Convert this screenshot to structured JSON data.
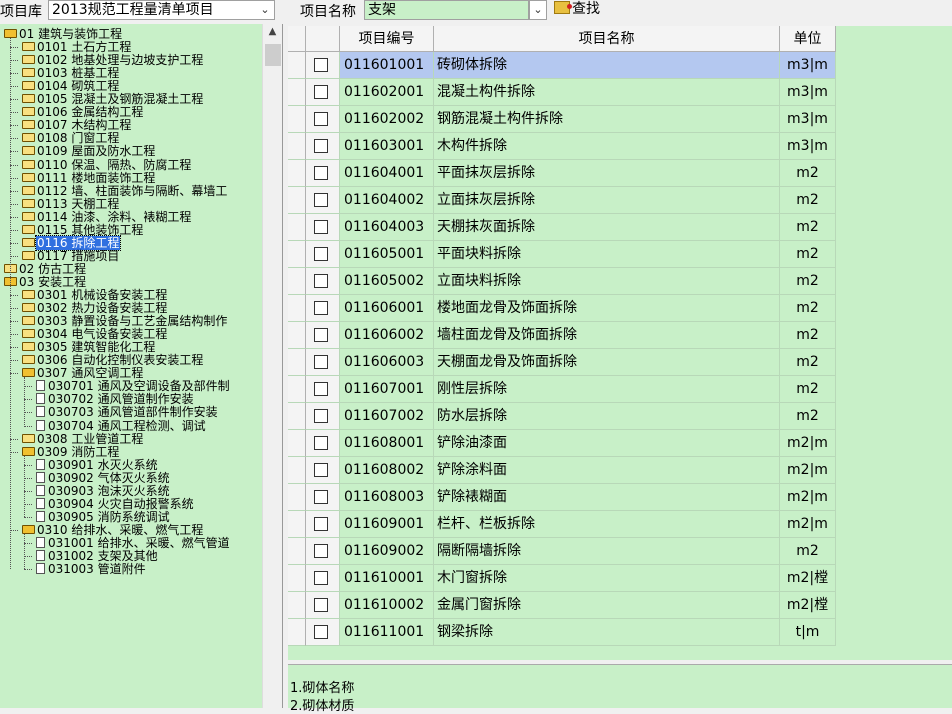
{
  "toolbar": {
    "library_label": "项目库",
    "library_value": "2013规范工程量清单项目",
    "name_label": "项目名称",
    "name_value": "支架",
    "find_label": "查找"
  },
  "tree": [
    {
      "label": "01 建筑与装饰工程",
      "type": "folder-open"
    },
    {
      "label": "0101 土石方工程",
      "type": "folder"
    },
    {
      "label": "0102 地基处理与边坡支护工程",
      "type": "folder"
    },
    {
      "label": "0103 桩基工程",
      "type": "folder"
    },
    {
      "label": "0104 砌筑工程",
      "type": "folder"
    },
    {
      "label": "0105 混凝土及钢筋混凝土工程",
      "type": "folder"
    },
    {
      "label": "0106 金属结构工程",
      "type": "folder"
    },
    {
      "label": "0107 木结构工程",
      "type": "folder"
    },
    {
      "label": "0108 门窗工程",
      "type": "folder"
    },
    {
      "label": "0109 屋面及防水工程",
      "type": "folder"
    },
    {
      "label": "0110 保温、隔热、防腐工程",
      "type": "folder"
    },
    {
      "label": "0111 楼地面装饰工程",
      "type": "folder"
    },
    {
      "label": "0112 墙、柱面装饰与隔断、幕墙工",
      "type": "folder"
    },
    {
      "label": "0113 天棚工程",
      "type": "folder"
    },
    {
      "label": "0114 油漆、涂料、裱糊工程",
      "type": "folder"
    },
    {
      "label": "0115 其他装饰工程",
      "type": "folder"
    },
    {
      "label": "0116 拆除工程",
      "type": "folder",
      "selected": true
    },
    {
      "label": "0117 措施项目",
      "type": "folder"
    },
    {
      "label": "02 仿古工程",
      "type": "folder"
    },
    {
      "label": "03 安装工程",
      "type": "folder-open"
    },
    {
      "label": "0301 机械设备安装工程",
      "type": "folder"
    },
    {
      "label": "0302 热力设备安装工程",
      "type": "folder"
    },
    {
      "label": "0303 静置设备与工艺金属结构制作",
      "type": "folder"
    },
    {
      "label": "0304 电气设备安装工程",
      "type": "folder"
    },
    {
      "label": "0305 建筑智能化工程",
      "type": "folder"
    },
    {
      "label": "0306 自动化控制仪表安装工程",
      "type": "folder"
    },
    {
      "label": "0307 通风空调工程",
      "type": "folder-open"
    },
    {
      "label": "030701 通风及空调设备及部件制",
      "type": "doc"
    },
    {
      "label": "030702 通风管道制作安装",
      "type": "doc"
    },
    {
      "label": "030703 通风管道部件制作安装",
      "type": "doc"
    },
    {
      "label": "030704 通风工程检测、调试",
      "type": "doc"
    },
    {
      "label": "0308 工业管道工程",
      "type": "folder"
    },
    {
      "label": "0309 消防工程",
      "type": "folder-open"
    },
    {
      "label": "030901 水灭火系统",
      "type": "doc"
    },
    {
      "label": "030902 气体灭火系统",
      "type": "doc"
    },
    {
      "label": "030903 泡沫灭火系统",
      "type": "doc"
    },
    {
      "label": "030904 火灾自动报警系统",
      "type": "doc"
    },
    {
      "label": "030905 消防系统调试",
      "type": "doc"
    },
    {
      "label": "0310 给排水、采暖、燃气工程",
      "type": "folder-open"
    },
    {
      "label": "031001 给排水、采暖、燃气管道",
      "type": "doc"
    },
    {
      "label": "031002 支架及其他",
      "type": "doc"
    },
    {
      "label": "031003 管道附件",
      "type": "doc"
    }
  ],
  "table": {
    "headers": {
      "code": "项目编号",
      "name": "项目名称",
      "unit": "单位"
    },
    "rows": [
      {
        "code": "011601001",
        "name": "砖砌体拆除",
        "unit": "m3|m"
      },
      {
        "code": "011602001",
        "name": "混凝土构件拆除",
        "unit": "m3|m"
      },
      {
        "code": "011602002",
        "name": "钢筋混凝土构件拆除",
        "unit": "m3|m"
      },
      {
        "code": "011603001",
        "name": "木构件拆除",
        "unit": "m3|m"
      },
      {
        "code": "011604001",
        "name": "平面抹灰层拆除",
        "unit": "m2"
      },
      {
        "code": "011604002",
        "name": "立面抹灰层拆除",
        "unit": "m2"
      },
      {
        "code": "011604003",
        "name": "天棚抹灰面拆除",
        "unit": "m2"
      },
      {
        "code": "011605001",
        "name": "平面块料拆除",
        "unit": "m2"
      },
      {
        "code": "011605002",
        "name": "立面块料拆除",
        "unit": "m2"
      },
      {
        "code": "011606001",
        "name": "楼地面龙骨及饰面拆除",
        "unit": "m2"
      },
      {
        "code": "011606002",
        "name": "墙柱面龙骨及饰面拆除",
        "unit": "m2"
      },
      {
        "code": "011606003",
        "name": "天棚面龙骨及饰面拆除",
        "unit": "m2"
      },
      {
        "code": "011607001",
        "name": "刚性层拆除",
        "unit": "m2"
      },
      {
        "code": "011607002",
        "name": "防水层拆除",
        "unit": "m2"
      },
      {
        "code": "011608001",
        "name": "铲除油漆面",
        "unit": "m2|m"
      },
      {
        "code": "011608002",
        "name": "铲除涂料面",
        "unit": "m2|m"
      },
      {
        "code": "011608003",
        "name": "铲除裱糊面",
        "unit": "m2|m"
      },
      {
        "code": "011609001",
        "name": "栏杆、栏板拆除",
        "unit": "m2|m"
      },
      {
        "code": "011609002",
        "name": "隔断隔墙拆除",
        "unit": "m2"
      },
      {
        "code": "011610001",
        "name": "木门窗拆除",
        "unit": "m2|樘"
      },
      {
        "code": "011610002",
        "name": "金属门窗拆除",
        "unit": "m2|樘"
      },
      {
        "code": "011611001",
        "name": "钢梁拆除",
        "unit": "t|m"
      }
    ]
  },
  "features": [
    "1.砌体名称",
    "2.砌体材质"
  ],
  "colors": {
    "panel_green": "#c8f0c8",
    "selection_blue": "#3070e0",
    "row_highlight": "#b4c8f0"
  }
}
